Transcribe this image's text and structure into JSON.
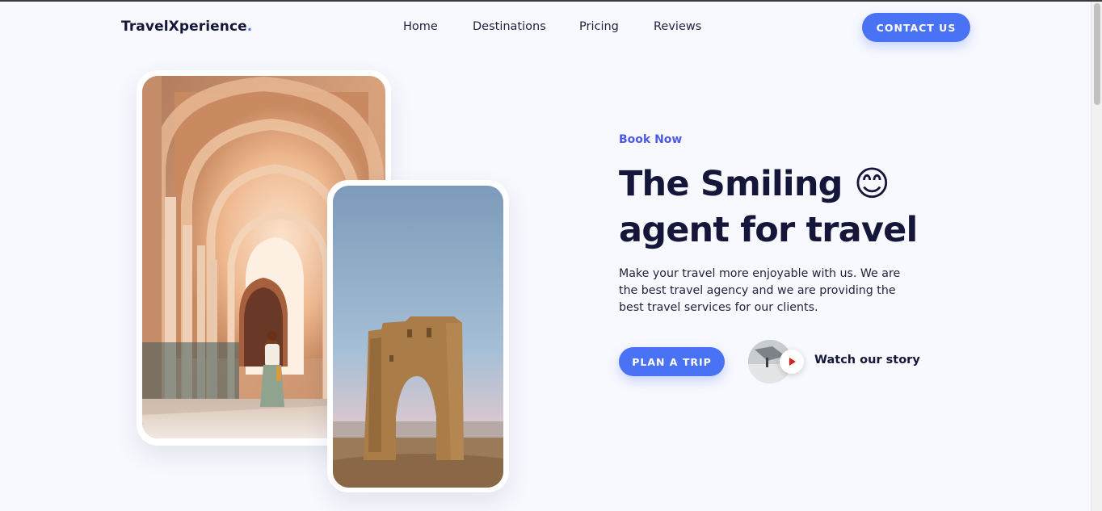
{
  "header": {
    "logo_text": "TravelXperience",
    "logo_dot": ".",
    "nav": [
      "Home",
      "Destinations",
      "Pricing",
      "Reviews"
    ],
    "contact_label": "CONTACT US"
  },
  "hero": {
    "eyebrow": "Book Now",
    "headline_line1": "The Smiling",
    "emoji": "😊",
    "headline_line2": "agent for travel",
    "description": "Make your travel more enjoyable with us. We are the best travel agency and we are providing the best travel services for our clients.",
    "plan_label": "PLAN A TRIP",
    "story_label": "Watch our story"
  },
  "colors": {
    "accent": "#4a72f5",
    "eyebrow": "#4b5ae8",
    "heading": "#14163a",
    "background": "#f8f9fe",
    "play_icon": "#e11d1d"
  },
  "icons": {
    "play": "play-icon"
  }
}
